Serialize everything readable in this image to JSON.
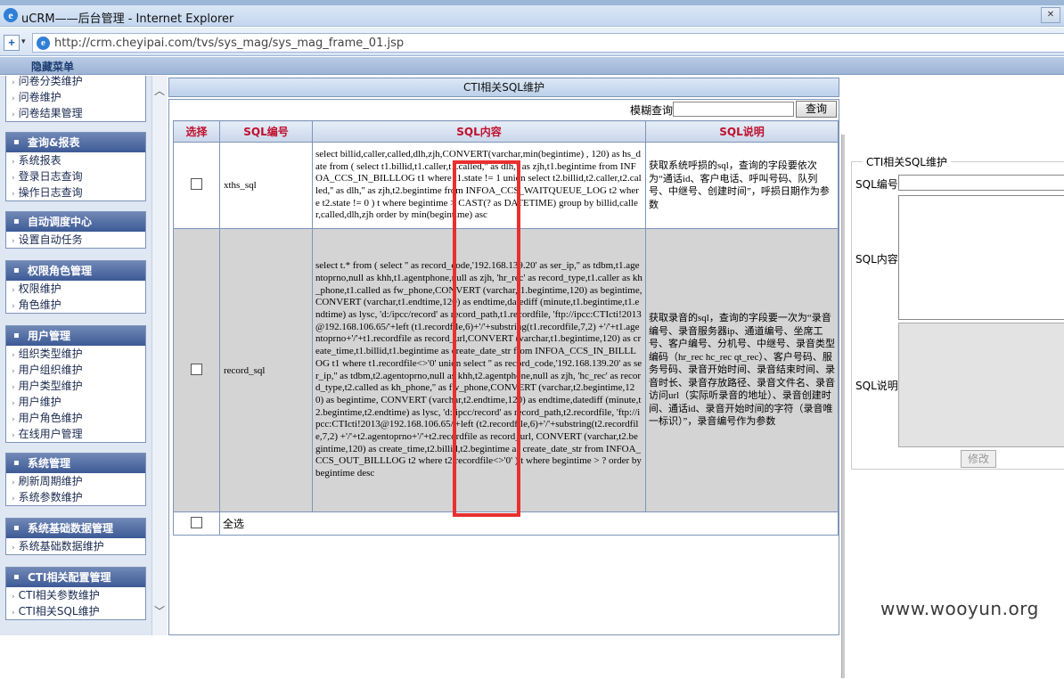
{
  "browser": {
    "title": "uCRM——后台管理 - Internet Explorer",
    "url": "http://crm.cheyipai.com/tvs/sys_mag/sys_mag_frame_01.jsp"
  },
  "header": {
    "hide_menu": "隐藏菜单"
  },
  "sidebar": {
    "top_items": [
      "问卷分类维护",
      "问卷维护",
      "问卷结果管理"
    ],
    "groups": [
      {
        "title": "查询&报表",
        "items": [
          "系统报表",
          "登录日志查询",
          "操作日志查询"
        ]
      },
      {
        "title": "自动调度中心",
        "items": [
          "设置自动任务"
        ]
      },
      {
        "title": "权限角色管理",
        "items": [
          "权限维护",
          "角色维护"
        ]
      },
      {
        "title": "用户管理",
        "items": [
          "组织类型维护",
          "用户组织维护",
          "用户类型维护",
          "用户维护",
          "用户角色维护",
          "在线用户管理"
        ]
      },
      {
        "title": "系统管理",
        "items": [
          "刷新周期维护",
          "系统参数维护"
        ]
      },
      {
        "title": "系统基础数据管理",
        "items": [
          "系统基础数据维护"
        ]
      },
      {
        "title": "CTI相关配置管理",
        "items": [
          "CTI相关参数维护",
          "CTI相关SQL维护"
        ]
      }
    ]
  },
  "main": {
    "title": "CTI相关SQL维护",
    "search_label": "模糊查询",
    "search_button": "查询",
    "columns": [
      "选择",
      "SQL编号",
      "SQL内容",
      "SQL说明"
    ],
    "rows": [
      {
        "code": "xths_sql",
        "content": "select billid,caller,called,dlh,zjh,CONVERT(varchar,min(begintime) , 120) as hs_date from ( select t1.billid,t1.caller,t1.called,'' as dlh,'' as zjh,t1.begintime from INFOA_CCS_IN_BILLLOG t1 where t1.state != 1 union select t2.billid,t2.caller,t2.called,'' as dlh,'' as zjh,t2.begintime from INFOA_CCS_WAITQUEUE_LOG t2 where t2.state != 0 ) t where begintime > CAST(? as DATETIME) group by billid,caller,called,dlh,zjh order by min(begintime) asc",
        "desc": "获取系统呼损的sql，查询的字段要依次为“通话id、客户电话、呼叫号码、队列号、中继号、创建时间”，呼损日期作为参数"
      },
      {
        "code": "record_sql",
        "content": "select t.* from ( select '' as record_code,'192.168.139.20' as ser_ip,'' as tdbm,t1.agentoprno,null as khh,t1.agentphone,null as zjh, 'hr_rec' as record_type,t1.caller as kh_phone,t1.called as fw_phone,CONVERT (varchar,t1.begintime,120) as begintime, CONVERT (varchar,t1.endtime,120) as endtime,datediff (minute,t1.begintime,t1.endtime) as lysc, 'd:/ipcc/record' as record_path,t1.recordfile, 'ftp://ipcc:CTIcti!2013@192.168.106.65/'+left (t1.recordfile,6)+'/'+substring(t1.recordfile,7,2) +'/'+t1.agentoprno+'/'+t1.recordfile as record_url,CONVERT (varchar,t1.begintime,120) as create_time,t1.billid,t1.begintime as create_date_str from INFOA_CCS_IN_BILLLOG t1 where t1.recordfile<>'0' union select '' as record_code,'192.168.139.20' as ser_ip,'' as tdbm,t2.agentoprno,null as khh,t2.agentphone,null as zjh, 'hc_rec' as record_type,t2.called as kh_phone,'' as fw_phone,CONVERT (varchar,t2.begintime,120) as begintime, CONVERT (varchar,t2.endtime,120) as endtime,datediff (minute,t2.begintime,t2.endtime) as lysc, 'd:/ipcc/record' as record_path,t2.recordfile, 'ftp://ipcc:CTIcti!2013@192.168.106.65/'+left (t2.recordfile,6)+'/'+substring(t2.recordfile,7,2) +'/'+t2.agentoprno+'/'+t2.recordfile as record_url, CONVERT (varchar,t2.begintime,120) as create_time,t2.billid,t2.begintime as create_date_str from INFOA_CCS_OUT_BILLLOG t2 where t2.recordfile<>'0' ) t where begintime > ? order by begintime desc",
        "desc": "获取录音的sql，查询的字段要一次为“录音编号、录音服务器ip、通道编号、坐席工号、客户编号、分机号、中继号、录音类型编码（hr_rec hc_rec qt_rec）、客户号码、服务号码、录音开始时间、录音结束时间、录音时长、录音存放路径、录音文件名、录音访问url（实际听录音的地址）、录音创建时间、通话id、录音开始时间的字符（录音唯一标识）”，录音编号作为参数"
      }
    ],
    "select_all": "全选"
  },
  "form": {
    "legend": "CTI相关SQL维护",
    "code_label": "SQL编号",
    "content_label": "SQL内容",
    "desc_label": "SQL说明",
    "modify_button": "修改"
  },
  "watermark": "www.wooyun.org"
}
